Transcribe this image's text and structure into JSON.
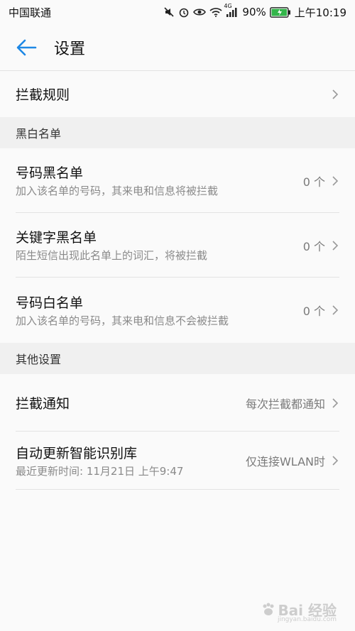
{
  "status": {
    "carrier": "中国联通",
    "network": "4G",
    "battery": "90%",
    "time": "上午10:19"
  },
  "header": {
    "title": "设置",
    "back_icon": "arrow-left-icon"
  },
  "rules": {
    "label": "拦截规则"
  },
  "blackwhite": {
    "section_title": "黑白名单",
    "items": [
      {
        "title": "号码黑名单",
        "desc": "加入该名单的号码，其来电和信息将被拦截",
        "count": "0 个"
      },
      {
        "title": "关键字黑名单",
        "desc": "陌生短信出现此名单上的词汇，将被拦截",
        "count": "0 个"
      },
      {
        "title": "号码白名单",
        "desc": "加入该名单的号码，其来电和信息不会被拦截",
        "count": "0 个"
      }
    ]
  },
  "other": {
    "section_title": "其他设置",
    "notify": {
      "title": "拦截通知",
      "value": "每次拦截都通知"
    },
    "update": {
      "title": "自动更新智能识别库",
      "desc": "最近更新时间: 11月21日 上午9:47",
      "value": "仅连接WLAN时"
    }
  },
  "watermark": {
    "text": "Bai 经验",
    "domain": "jingyan.baidu.com"
  },
  "colors": {
    "accent": "#1e88e5",
    "battery": "#33b54a"
  }
}
